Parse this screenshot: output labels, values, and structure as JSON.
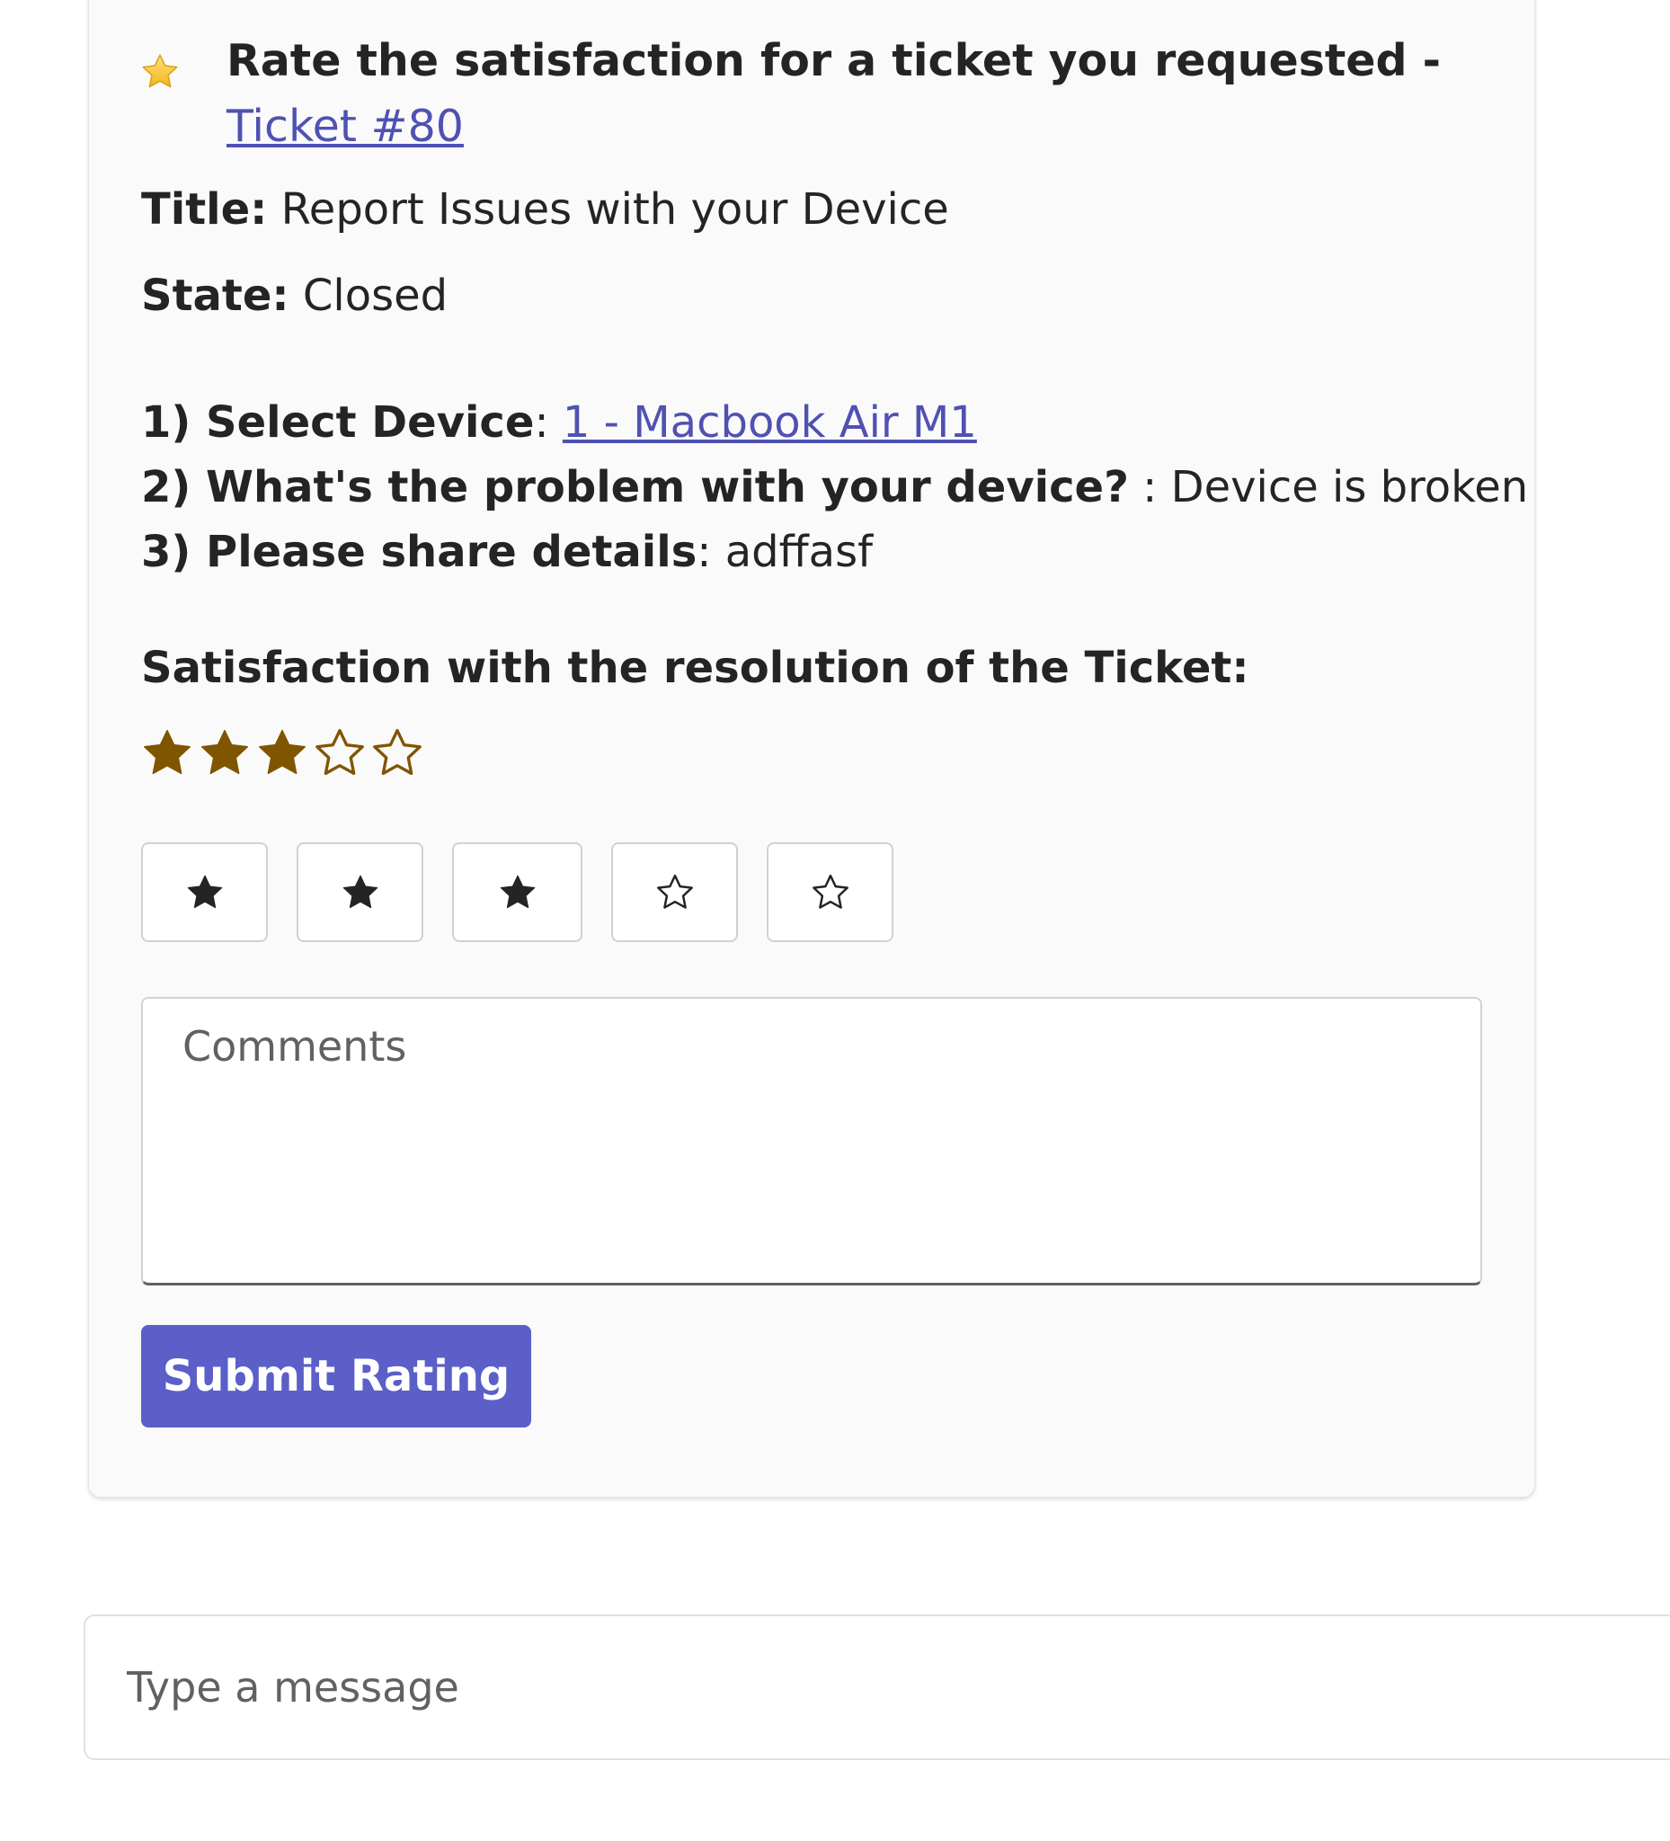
{
  "card": {
    "header": {
      "icon": "star-icon",
      "text": "Rate the satisfaction for a ticket you requested - ",
      "ticket_link": "Ticket #80"
    },
    "title": {
      "label": "Title:",
      "value": " Report Issues with your Device"
    },
    "state": {
      "label": "State:",
      "value": " Closed"
    },
    "answers": [
      {
        "label": "1) Select Device",
        "separator": ": ",
        "value": "1 - Macbook Air M1",
        "is_link": true
      },
      {
        "label": "2) What's the problem with your device?",
        "separator": " : ",
        "value": "Device is broken",
        "is_link": false
      },
      {
        "label": "3) Please share details",
        "separator": ": ",
        "value": "adffasf",
        "is_link": false
      }
    ],
    "satisfaction_heading": "Satisfaction with the resolution of the Ticket:",
    "rating": {
      "value": 3,
      "max": 5,
      "filled_color": "#805500",
      "empty_color": "#805500"
    },
    "rating_buttons": [
      {
        "icon": "star-filled-icon"
      },
      {
        "icon": "star-filled-icon"
      },
      {
        "icon": "star-filled-icon"
      },
      {
        "icon": "star-outline-icon"
      },
      {
        "icon": "star-outline-icon"
      }
    ],
    "comments": {
      "placeholder": "Comments",
      "value": ""
    },
    "submit_label": "Submit Rating"
  },
  "composer": {
    "placeholder": "Type a message",
    "value": ""
  },
  "colors": {
    "link": "#4f52b2",
    "primary_button": "#5b5fc7",
    "card_background": "#fafafa",
    "header_star": "#f7c948"
  }
}
